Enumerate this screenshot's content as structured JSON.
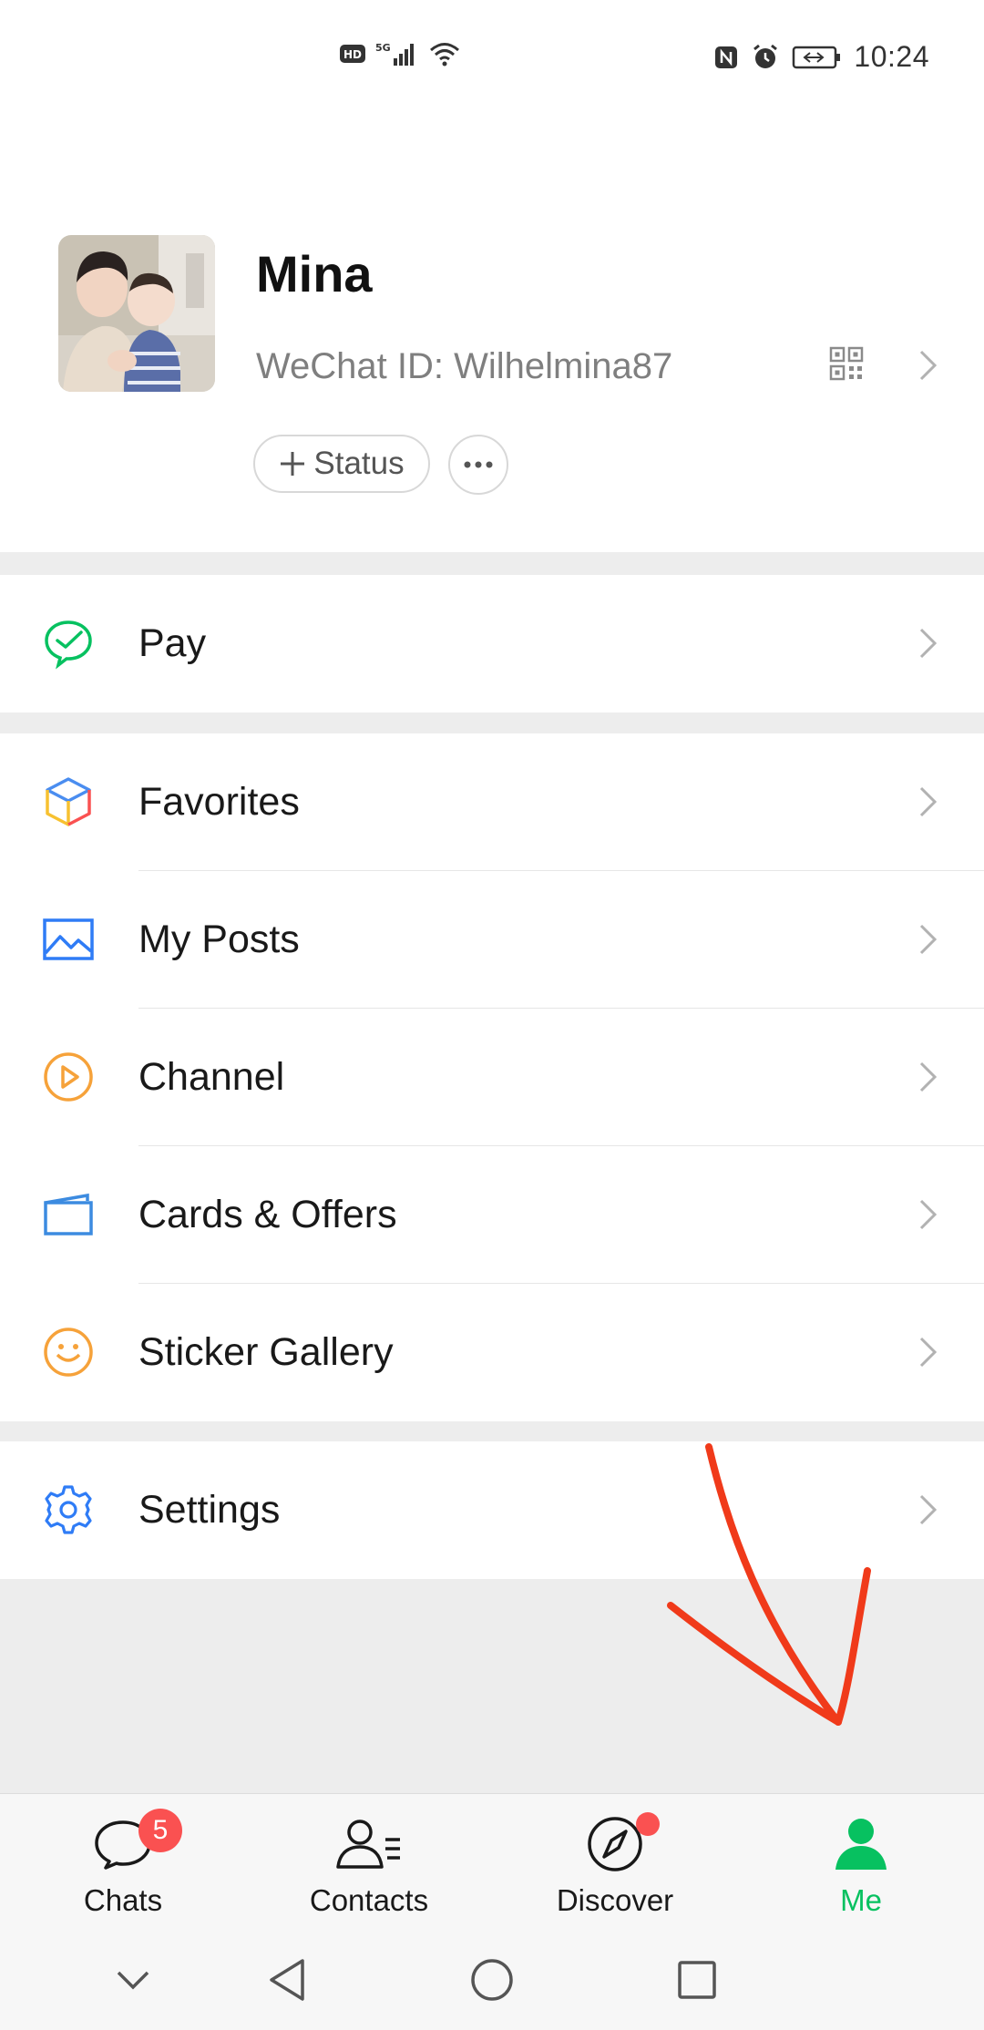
{
  "status_bar": {
    "time": "10:24",
    "left_icons": [
      "hd-icon",
      "5g-signal-icon",
      "wifi-icon"
    ],
    "right_icons": [
      "nfc-icon",
      "alarm-icon",
      "battery-icon"
    ]
  },
  "profile": {
    "name": "Mina",
    "wechat_id": "WeChat ID: Wilhelmina87",
    "status_button": "Status",
    "more_button": "more-icon"
  },
  "menu": {
    "pay": "Pay",
    "favorites": "Favorites",
    "my_posts": "My Posts",
    "channel": "Channel",
    "cards_offers": "Cards & Offers",
    "sticker_gallery": "Sticker Gallery",
    "settings": "Settings"
  },
  "tabs": {
    "chats": "Chats",
    "chats_badge": "5",
    "contacts": "Contacts",
    "discover": "Discover",
    "me": "Me"
  },
  "colors": {
    "accent_green": "#07c160",
    "badge_red": "#fa5151",
    "annotation_red": "#f03a1a"
  }
}
